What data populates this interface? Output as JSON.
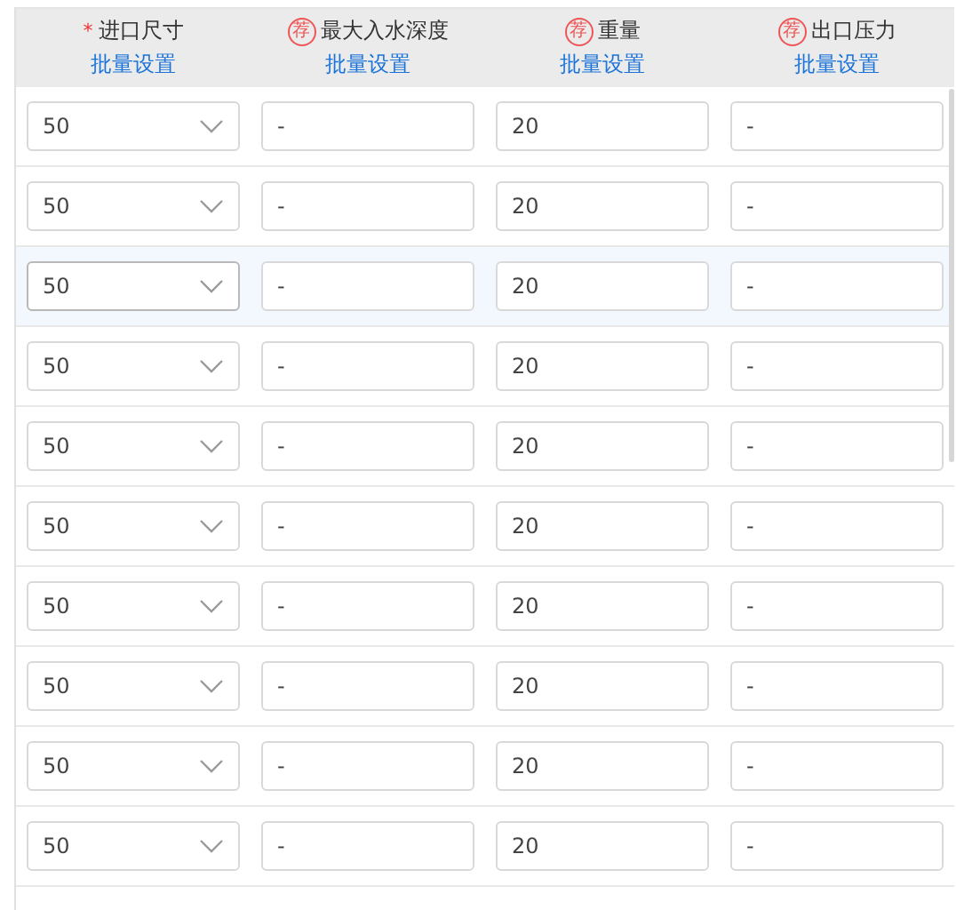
{
  "columns": [
    {
      "kind": "select",
      "required_mark": "*",
      "title": "进口尺寸",
      "action": "批量设置"
    },
    {
      "kind": "input",
      "badge": "荐",
      "title": "最大入水深度",
      "action": "批量设置"
    },
    {
      "kind": "input",
      "badge": "荐",
      "title": "重量",
      "action": "批量设置"
    },
    {
      "kind": "input",
      "badge": "荐",
      "title": "出口压力",
      "action": "批量设置"
    }
  ],
  "rows": [
    {
      "hovered": false,
      "cells": [
        "50",
        "-",
        "20",
        "-"
      ]
    },
    {
      "hovered": false,
      "cells": [
        "50",
        "-",
        "20",
        "-"
      ]
    },
    {
      "hovered": true,
      "cells": [
        "50",
        "-",
        "20",
        "-"
      ]
    },
    {
      "hovered": false,
      "cells": [
        "50",
        "-",
        "20",
        "-"
      ]
    },
    {
      "hovered": false,
      "cells": [
        "50",
        "-",
        "20",
        "-"
      ]
    },
    {
      "hovered": false,
      "cells": [
        "50",
        "-",
        "20",
        "-"
      ]
    },
    {
      "hovered": false,
      "cells": [
        "50",
        "-",
        "20",
        "-"
      ]
    },
    {
      "hovered": false,
      "cells": [
        "50",
        "-",
        "20",
        "-"
      ]
    },
    {
      "hovered": false,
      "cells": [
        "50",
        "-",
        "20",
        "-"
      ]
    },
    {
      "hovered": false,
      "cells": [
        "50",
        "-",
        "20",
        "-"
      ]
    }
  ]
}
